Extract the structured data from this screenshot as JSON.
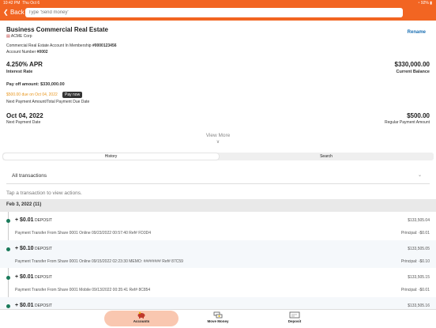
{
  "status": {
    "time": "10:42 PM",
    "date": "Thu Oct 6",
    "battery": "92%"
  },
  "nav": {
    "back_label": "Back",
    "search_placeholder": "Type 'Send money'"
  },
  "account": {
    "name": "Business Commercial Real Estate",
    "org": "ACME Corp",
    "rename_label": "Rename",
    "membership_label": "Commercial Real Estate Account In Membership",
    "membership_number": "#0000123456",
    "account_number_label": "Account Number",
    "account_number": "#0002",
    "rate": "4.250% APR",
    "rate_label": "Interest Rate",
    "balance": "$330,000.00",
    "balance_label": "Current Balance",
    "payoff": "Pay off amount: $330,000.00",
    "due_text": "$500.00 due on Oct 04, 2022",
    "pay_now_label": "Pay now",
    "due_label": "Next Payment Amount/Total Payment Due Date",
    "next_date": "Oct 04, 2022",
    "next_date_label": "Next Payment Date",
    "regular_amount": "$500.00",
    "regular_amount_label": "Regular Payment Amount",
    "view_more": "View More"
  },
  "segments": {
    "history": "History",
    "search": "Search"
  },
  "filter": {
    "value": "All transactions"
  },
  "hint": "Tap a transaction to view actions.",
  "group": {
    "label": "Feb 3, 2022 (11)"
  },
  "transactions": [
    {
      "amount": "+ $0.01",
      "type": "DEPOSIT",
      "balance": "$133,505.04",
      "desc": "Payment Transfer From Share 0001 Online 09/23/2022 00:57:40 Ref# FD3D4",
      "principal": "Principal: -$0.01"
    },
    {
      "amount": "+ $0.10",
      "type": "DEPOSIT",
      "balance": "$133,505.05",
      "desc": "Payment Transfer From Share 0001 Online 09/15/2022 02:23:30 MEMO: ######## Ref# 87C59",
      "principal": "Principal: -$0.10"
    },
    {
      "amount": "+ $0.01",
      "type": "DEPOSIT",
      "balance": "$133,505.15",
      "desc": "Payment Transfer From Share 0001 Mobile 09/13/2022 00:35:41 Ref# 8C854",
      "principal": "Principal: -$0.01"
    },
    {
      "amount": "+ $0.01",
      "type": "DEPOSIT",
      "balance": "$133,505.16",
      "desc": "",
      "principal": ""
    }
  ],
  "tabs": [
    {
      "label": "Accounts",
      "icon": "piggy-bank-icon"
    },
    {
      "label": "Move Money",
      "icon": "move-money-icon"
    },
    {
      "label": "Deposit",
      "icon": "check-deposit-icon"
    }
  ],
  "colors": {
    "brand": "#f26522",
    "link": "#1a6fb3",
    "due": "#e8961e",
    "dot": "#1a7a5a",
    "active_tab": "#f9c7b0"
  }
}
